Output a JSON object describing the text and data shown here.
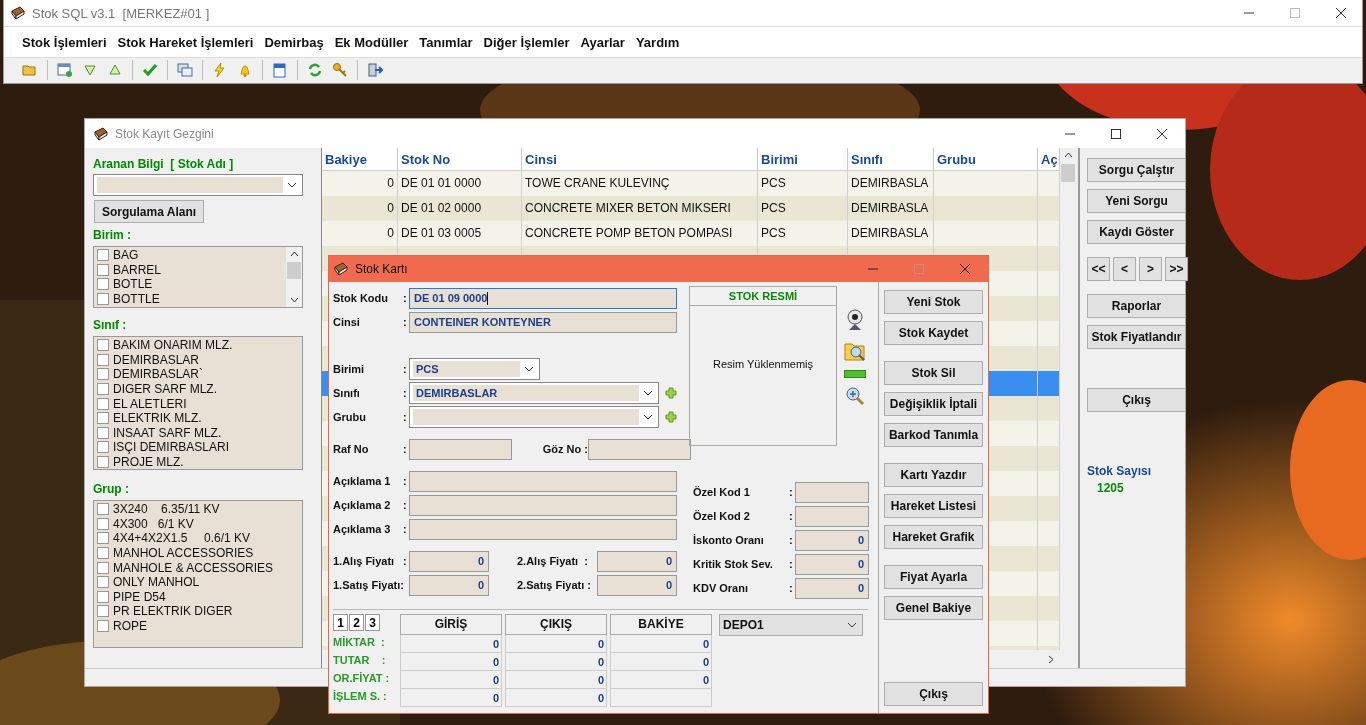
{
  "app": {
    "title": "Stok SQL v3.1  [MERKEZ#01 ]",
    "menu": [
      "Stok İşlemleri",
      "Stok Hareket İşlemleri",
      "Demirbaş",
      "Ek Modüller",
      "Tanımlar",
      "Diğer İşlemler",
      "Ayarlar",
      "Yardım"
    ]
  },
  "browser": {
    "title": "Stok Kayıt Gezgini",
    "search_label": "Aranan Bilgi  [ Stok Adı ]",
    "query_button": "Sorgulama Alanı",
    "filters": [
      {
        "label": "Birim :",
        "scrollable": true,
        "items": [
          {
            "label": "BAG",
            "checked": false
          },
          {
            "label": "BARREL",
            "checked": false
          },
          {
            "label": "BOTLE",
            "checked": false
          },
          {
            "label": "BOTTLE",
            "checked": false
          }
        ]
      },
      {
        "label": "Sınıf :",
        "scrollable": false,
        "items": [
          {
            "label": "BAKIM ONARIM MLZ.",
            "checked": false
          },
          {
            "label": "DEMIRBASLAR",
            "checked": false
          },
          {
            "label": "DEMIRBASLAR`",
            "checked": false
          },
          {
            "label": "DIGER SARF MLZ.",
            "checked": false
          },
          {
            "label": "EL ALETLERI",
            "checked": false
          },
          {
            "label": "ELEKTRIK MLZ.",
            "checked": false
          },
          {
            "label": "INSAAT SARF MLZ.",
            "checked": false
          },
          {
            "label": "ISÇI DEMIRBASLARI",
            "checked": false
          },
          {
            "label": "PROJE MLZ.",
            "checked": false
          }
        ]
      },
      {
        "label": "Grup :",
        "scrollable": false,
        "items": [
          {
            "label": "3X240    6.35/11 KV",
            "checked": false
          },
          {
            "label": "4X300   6/1 KV",
            "checked": false
          },
          {
            "label": "4X4+4X2X1.5     0.6/1 KV",
            "checked": false
          },
          {
            "label": "MANHOL ACCESSORIES",
            "checked": false
          },
          {
            "label": "MANHOLE & ACCESSORIES",
            "checked": false
          },
          {
            "label": "ONLY MANHOL",
            "checked": false
          },
          {
            "label": "PIPE D54",
            "checked": false
          },
          {
            "label": "PR ELEKTRIK DIGER",
            "checked": false
          },
          {
            "label": "ROPE",
            "checked": false
          }
        ]
      }
    ],
    "columns": [
      "Bakiye",
      "Stok No",
      "Cinsi",
      "Birimi",
      "Sınıfı",
      "Grubu",
      "Aç"
    ],
    "rows": [
      {
        "bakiye": "0",
        "stok_no": "DE 01 01 0000",
        "cinsi": "TOWE CRANE KULEVINÇ",
        "birimi": "PCS",
        "sinifi": "DEMIRBASLA",
        "selected": false
      },
      {
        "bakiye": "0",
        "stok_no": "DE 01 02 0000",
        "cinsi": "CONCRETE MIXER BETON MIKSERI",
        "birimi": "PCS",
        "sinifi": "DEMIRBASLA",
        "selected": false
      },
      {
        "bakiye": "0",
        "stok_no": "DE 01 03 0005",
        "cinsi": "CONCRETE POMP BETON POMPASI",
        "birimi": "PCS",
        "sinifi": "DEMIRBASLA",
        "selected": false
      }
    ],
    "covered_rows": [
      {
        "selected": false
      },
      {
        "selected": false
      },
      {
        "selected": false
      },
      {
        "selected": false
      },
      {
        "selected": false
      },
      {
        "selected": true
      },
      {
        "selected": false
      },
      {
        "selected": false
      },
      {
        "selected": false
      },
      {
        "selected": false
      },
      {
        "selected": false
      },
      {
        "selected": false
      },
      {
        "selected": false
      },
      {
        "selected": false
      },
      {
        "selected": false
      },
      {
        "selected": false
      },
      {
        "selected": false
      }
    ],
    "button_groups": [
      [
        "Sorgu Çalştır",
        "Yeni Sorgu",
        "Kaydı Göster"
      ]
    ],
    "nav": [
      "<<",
      "<",
      ">",
      ">>"
    ],
    "report_buttons": [
      "Raporlar",
      "Stok Fiyatlandır"
    ],
    "exit_button": "Çıkış",
    "count_label": "Stok Sayısı",
    "count": "1205"
  },
  "card": {
    "title": "Stok Kartı",
    "stok_kodu": {
      "label": "Stok Kodu",
      "colon": ":",
      "value": "DE 01 09 0000",
      "focused": true
    },
    "cinsi": {
      "label": "Cinsi",
      "colon": ":",
      "value": "CONTEINER KONTEYNER"
    },
    "birimi": {
      "label": "Birimi",
      "colon": ":",
      "value": "PCS"
    },
    "sinifi": {
      "label": "Sınıfı",
      "colon": ":",
      "value": "DEMIRBASLAR"
    },
    "grubu": {
      "label": "Grubu",
      "colon": ":"
    },
    "raf_no": {
      "label": "Raf No",
      "colon": ":"
    },
    "goz_no": {
      "label": "Göz No :"
    },
    "aciklama": [
      {
        "label": "Açıklama 1",
        "colon": ":"
      },
      {
        "label": "Açıklama 2",
        "colon": ":"
      },
      {
        "label": "Açıklama 3",
        "colon": ":"
      }
    ],
    "prices": [
      {
        "label": "1.Alış Fiyatı",
        "colon": ":",
        "value": "0",
        "label2": "2.Alış Fiyatı  :",
        "value2": "0"
      },
      {
        "label": "1.Satış Fiyatı:",
        "value": "0",
        "label2": "2.Satış Fiyatı :",
        "value2": "0"
      }
    ],
    "picture": {
      "title": "STOK RESMİ",
      "empty_text": "Resim Yüklenmemiş"
    },
    "codes": [
      {
        "label": "Özel Kod 1",
        "colon": ":"
      },
      {
        "label": "Özel Kod 2",
        "colon": ":"
      },
      {
        "label": "İskonto Oranı",
        "colon": ":",
        "value": "0"
      },
      {
        "label": "Kritik Stok Sev.",
        "colon": ":",
        "value": "0"
      },
      {
        "label": "KDV Oranı",
        "colon": ":",
        "value": "0"
      }
    ],
    "pages": [
      "1",
      "2",
      "3"
    ],
    "movement_columns": [
      "GİRİŞ",
      "ÇIKIŞ",
      "BAKİYE"
    ],
    "movement_rows": [
      {
        "label": "MİKTAR  :",
        "values": [
          "0",
          "0",
          "0"
        ]
      },
      {
        "label": "TUTAR    :",
        "values": [
          "0",
          "0",
          "0"
        ]
      },
      {
        "label": "OR.FİYAT :",
        "values": [
          "0",
          "0",
          "0"
        ]
      },
      {
        "label": "İŞLEM S. :",
        "values": [
          "0",
          "0"
        ]
      }
    ],
    "depot": "DEPO1",
    "button_groups": [
      [
        "Yeni Stok",
        "Stok Kaydet"
      ],
      [
        "Stok Sil",
        "Değişiklik İptali",
        "Barkod Tanımla"
      ],
      [
        "Kartı Yazdır",
        "Hareket Listesi",
        "Hareket Grafik"
      ],
      [
        "Fiyat Ayarla",
        "Genel Bakiye"
      ]
    ],
    "exit_button": "Çıkış"
  }
}
